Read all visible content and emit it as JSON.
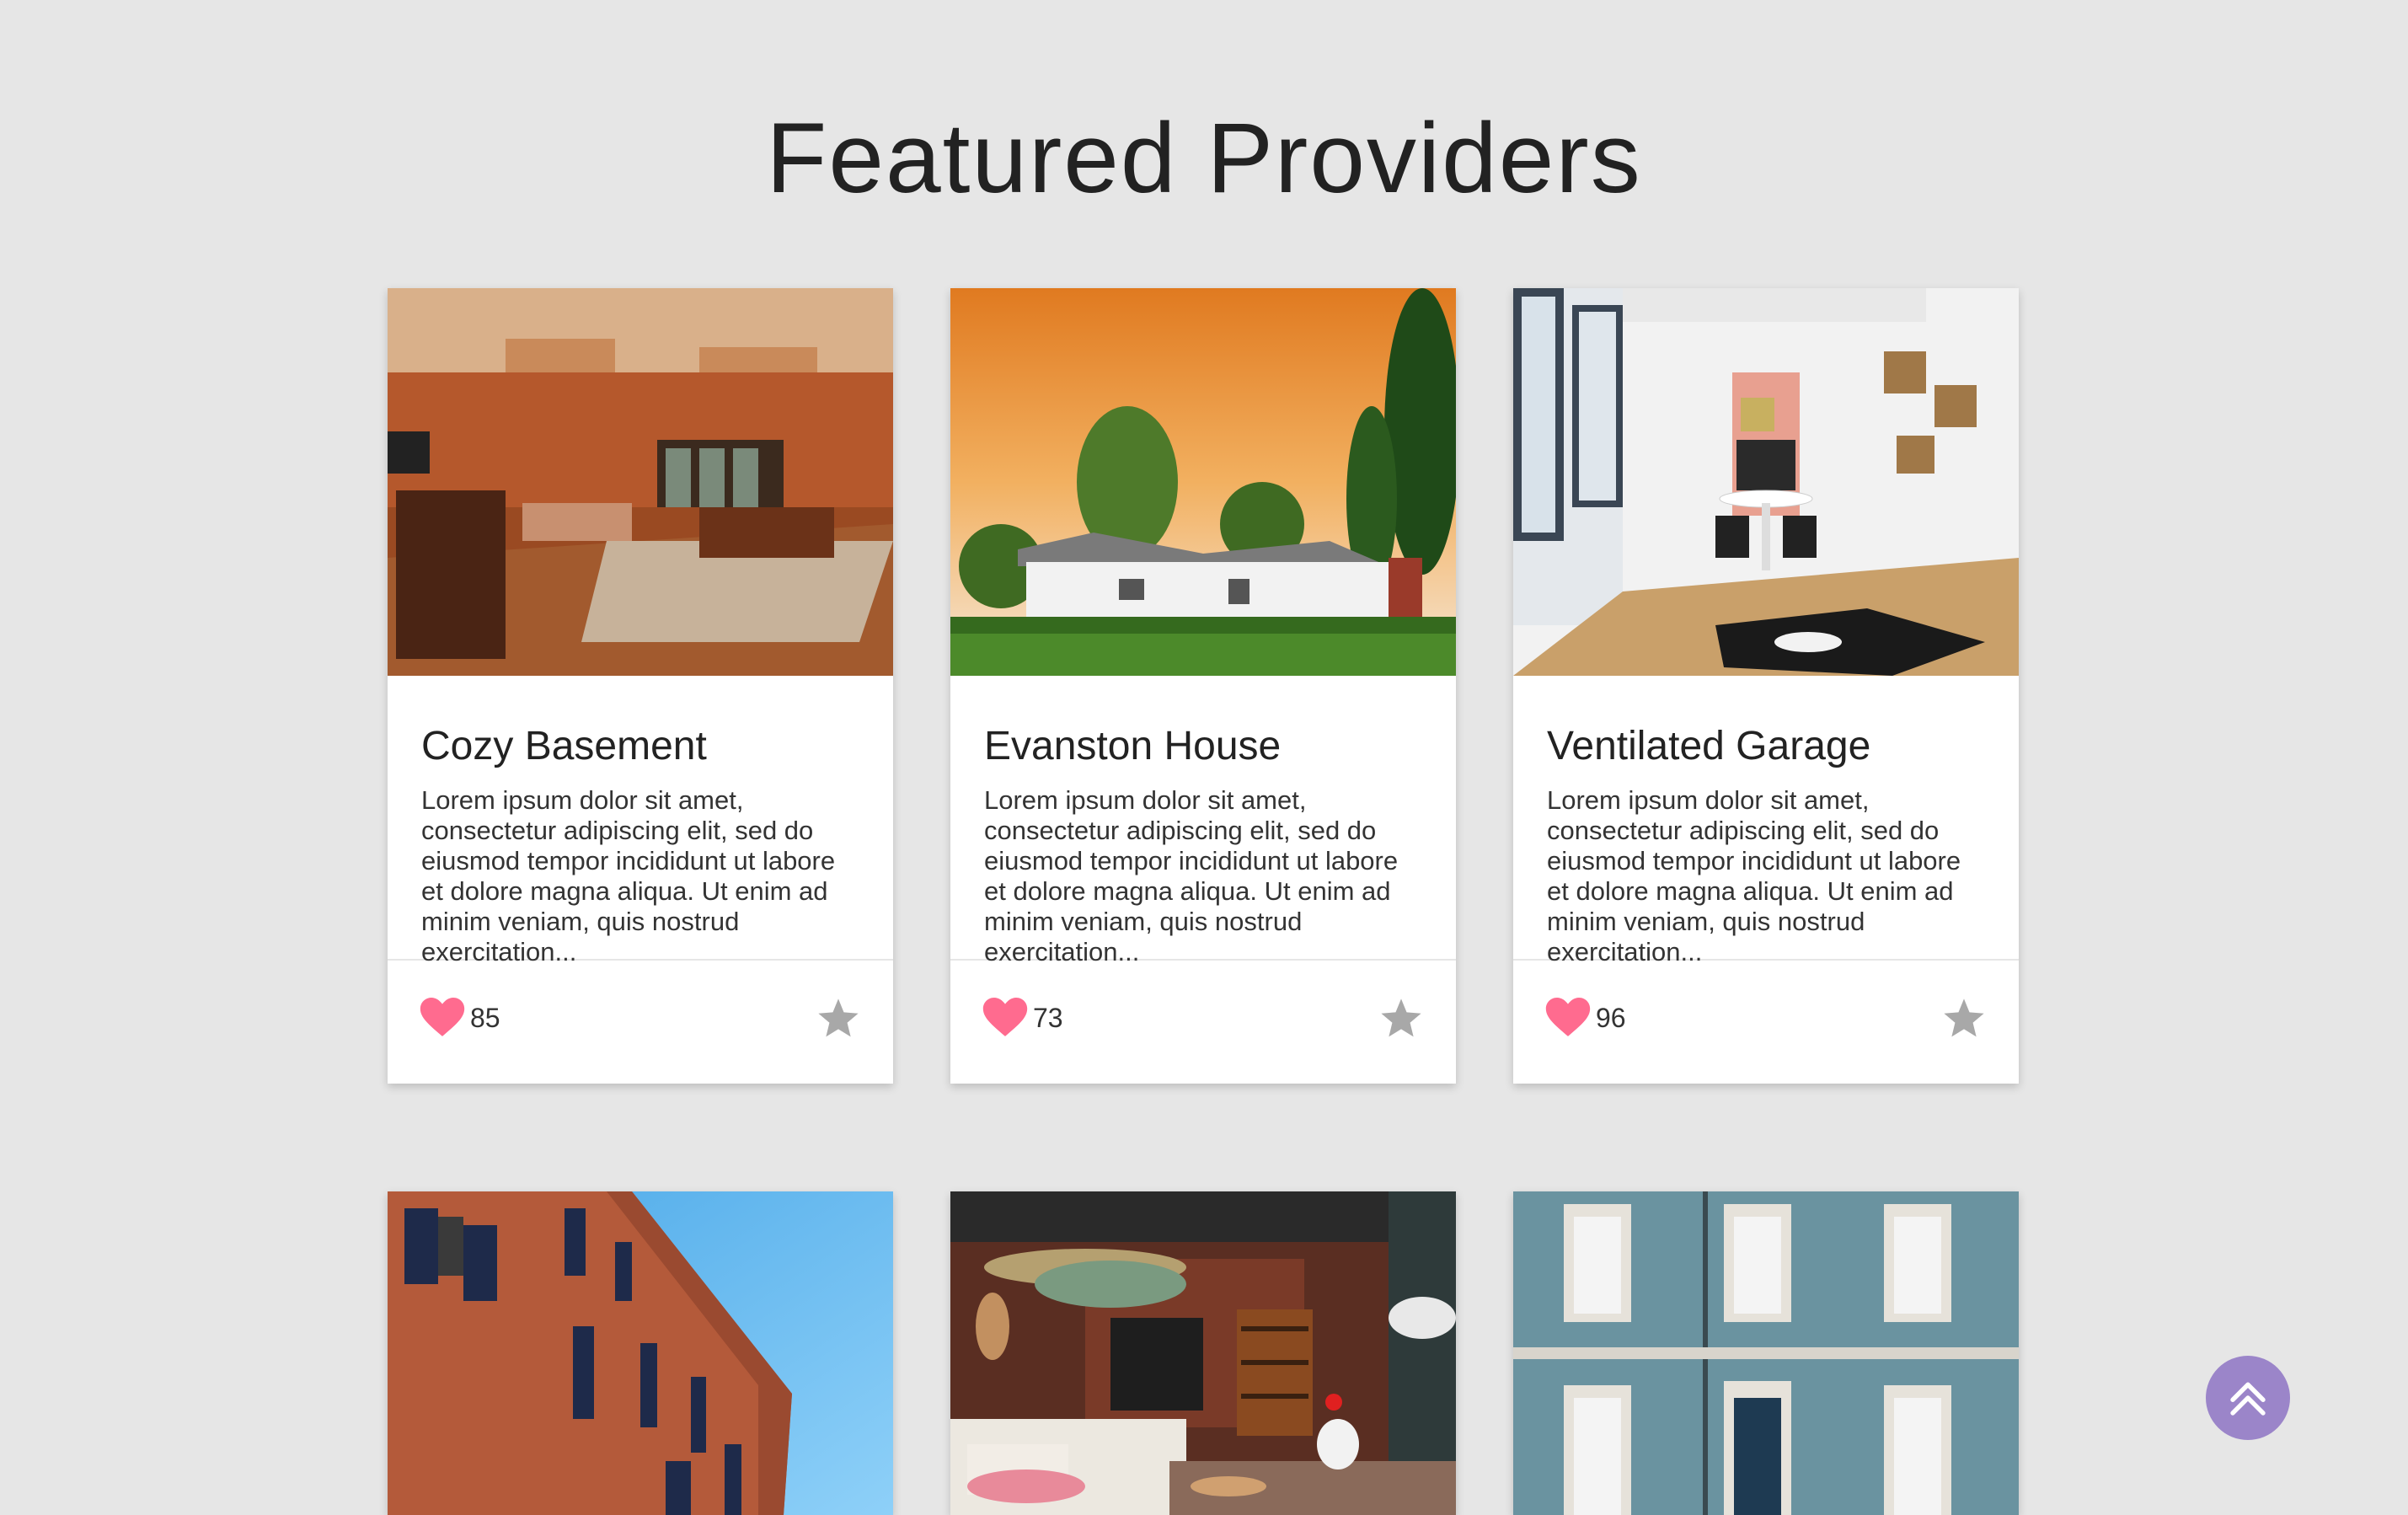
{
  "page": {
    "title": "Featured Providers"
  },
  "cards": [
    {
      "title": "Cozy Basement",
      "description": "Lorem ipsum dolor sit amet, consectetur adipiscing elit, sed do eiusmod tempor incididunt ut labore et dolore magna aliqua. Ut enim ad minim veniam, quis nostrud exercitation...",
      "likes": "85",
      "image": "basement-photo"
    },
    {
      "title": "Evanston House",
      "description": "Lorem ipsum dolor sit amet, consectetur adipiscing elit, sed do eiusmod tempor incididunt ut labore et dolore magna aliqua. Ut enim ad minim veniam, quis nostrud exercitation...",
      "likes": "73",
      "image": "house-photo"
    },
    {
      "title": "Ventilated Garage",
      "description": "Lorem ipsum dolor sit amet, consectetur adipiscing elit, sed do eiusmod tempor incididunt ut labore et dolore magna aliqua. Ut enim ad minim veniam, quis nostrud exercitation...",
      "likes": "96",
      "image": "garage-photo"
    },
    {
      "image": "terracotta-building-photo"
    },
    {
      "image": "loft-living-room-photo"
    },
    {
      "image": "blue-tiled-facade-photo"
    }
  ],
  "icons": {
    "like": "heart-icon",
    "favorite": "star-icon",
    "scroll_top": "double-chevron-up-icon"
  },
  "colors": {
    "background": "#e6e6e6",
    "heart": "#ff6b8f",
    "star": "#a8a8a8",
    "scroll_button": "#9b85c9"
  }
}
